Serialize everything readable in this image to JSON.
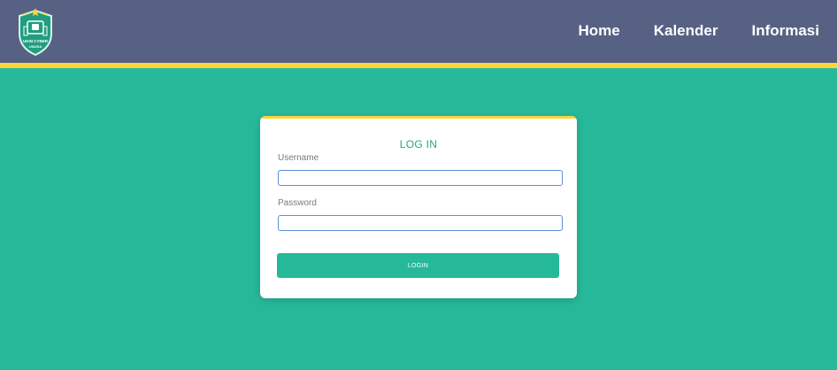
{
  "header": {
    "logo_text_line1": "UKIN CYBER",
    "logo_text_line2": "UNUSA",
    "nav": [
      {
        "label": "Home"
      },
      {
        "label": "Kalender"
      },
      {
        "label": "Informasi"
      }
    ]
  },
  "login": {
    "title": "LOG IN",
    "username_label": "Username",
    "username_value": "",
    "password_label": "Password",
    "password_value": "",
    "button_label": "LOGIN"
  },
  "colors": {
    "navbar": "#576183",
    "accent_yellow": "#fcd43b",
    "background_green": "#26b999",
    "title_green": "#22a68a",
    "input_border": "#5b8edb"
  }
}
